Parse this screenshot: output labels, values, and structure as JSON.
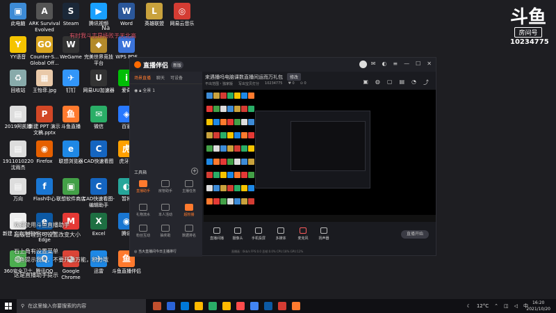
{
  "desktop": {
    "icons": [
      {
        "label": "此电脑",
        "color": "#3d8bd6",
        "glyph": "▣"
      },
      {
        "label": "ARK Survival Evolved",
        "color": "#555",
        "glyph": "A"
      },
      {
        "label": "Steam",
        "color": "#1b2838",
        "glyph": "S"
      },
      {
        "label": "腾讯视频",
        "color": "#19a0ff",
        "glyph": "▶"
      },
      {
        "label": "Word",
        "color": "#2b579a",
        "glyph": "W"
      },
      {
        "label": "英雄联盟",
        "color": "#c9a23d",
        "glyph": "L"
      },
      {
        "label": "网易云音乐",
        "color": "#d43c33",
        "glyph": "◎"
      },
      {
        "label": "YY语音",
        "color": "#f5c400",
        "glyph": "Y"
      },
      {
        "label": "Counter-S... Global Off...",
        "color": "#d9a520",
        "glyph": "GO"
      },
      {
        "label": "WeGame",
        "color": "#333",
        "glyph": "W"
      },
      {
        "label": "完美世界竞技平台",
        "color": "#b38a2b",
        "glyph": "◆"
      },
      {
        "label": "WPS PDF",
        "color": "#3b73d9",
        "glyph": "W"
      },
      {
        "label": "回收站",
        "color": "#8aa",
        "glyph": "♻"
      },
      {
        "label": "王怡菲.jpg",
        "color": "#e9c9a9",
        "glyph": "▦"
      },
      {
        "label": "钉钉",
        "color": "#3296fa",
        "glyph": "✈"
      },
      {
        "label": "网易UU加速器",
        "color": "#333",
        "glyph": "U"
      },
      {
        "label": "爱奇",
        "color": "#00be06",
        "glyph": "i"
      },
      {
        "label": "2019阿凯娜",
        "color": "#ddd",
        "glyph": "▤"
      },
      {
        "label": "新建 PPT 演示文稿.pptx",
        "color": "#d24726",
        "glyph": "P"
      },
      {
        "label": "斗鱼直播",
        "color": "#ff7a2e",
        "glyph": "鱼"
      },
      {
        "label": "微信",
        "color": "#2aae67",
        "glyph": "✉"
      },
      {
        "label": "百家",
        "color": "#2878ff",
        "glyph": "◈"
      },
      {
        "label": "1911010220 沈雨杰",
        "color": "#ddd",
        "glyph": "▤"
      },
      {
        "label": "Firefox",
        "color": "#e66000",
        "glyph": "◉"
      },
      {
        "label": "联想浏览器",
        "color": "#1e88e5",
        "glyph": "e"
      },
      {
        "label": "CAD快速看图",
        "color": "#1565c0",
        "glyph": "C"
      },
      {
        "label": "虎牙直",
        "color": "#ffa000",
        "glyph": "虎"
      },
      {
        "label": "万向",
        "color": "#ddd",
        "glyph": "▤"
      },
      {
        "label": "Flash中心",
        "color": "#1976d2",
        "glyph": "f"
      },
      {
        "label": "联想软件商店",
        "color": "#43a047",
        "glyph": "▣"
      },
      {
        "label": "CAD快速看图-编辑助手",
        "color": "#1565c0",
        "glyph": "C"
      },
      {
        "label": "暂将",
        "color": "#26a69a",
        "glyph": "◐"
      },
      {
        "label": "新建 文本文档",
        "color": "#eee",
        "glyph": "▤"
      },
      {
        "label": "Microsoft Edge",
        "color": "#0c59a4",
        "glyph": "e"
      },
      {
        "label": "",
        "color": "#e53935",
        "glyph": "M"
      },
      {
        "label": "Excel",
        "color": "#1d6f42",
        "glyph": "X"
      },
      {
        "label": "腾讯",
        "color": "#1976d2",
        "glyph": "◉"
      },
      {
        "label": "360安全卫士",
        "color": "#4caf50",
        "glyph": "◍"
      },
      {
        "label": "腾讯QQ",
        "color": "#1e88e5",
        "glyph": "Q"
      },
      {
        "label": "Google Chrome",
        "color": "#db4437",
        "glyph": "◕"
      },
      {
        "label": "迅雷",
        "color": "#1e88e5",
        "glyph": "✈"
      },
      {
        "label": "斗鱼直播伴侣",
        "color": "#ff7a2e",
        "glyph": "鱼"
      }
    ]
  },
  "watermark": {
    "logo": "斗鱼",
    "sub": "房间号",
    "room": "10234775"
  },
  "overlays": {
    "na": "Na",
    "pink_line": "有时我斗志昂扬败于天北高",
    "line1": "欢迎使用斗鱼直播助手",
    "line2": "超级管理员可设置改变大小",
    "line3": "石上角有设置菜单",
    "line4": "斗鱼提示我们，不要开通万能，积分哦",
    "line5": "这是直播助手提示",
    "taskbar_hint": "直播显示不到Ⅲ"
  },
  "app": {
    "brand": "直播伴侣",
    "version": "新版",
    "side_tabs": [
      "场景直播",
      "聊天",
      "可设备"
    ],
    "scene_label": "全景 1",
    "tools_title": "工具箱",
    "tools": [
      {
        "label": "直播助手",
        "orange": true
      },
      {
        "label": "房管助手",
        "orange": false
      },
      {
        "label": "主播任务",
        "orange": false
      },
      {
        "label": "礼物流水",
        "orange": false
      },
      {
        "label": "本人活动",
        "orange": false
      },
      {
        "label": "超粉播",
        "orange": true
      },
      {
        "label": "粉丝互动",
        "orange": false
      },
      {
        "label": "抽奖助",
        "orange": false
      },
      {
        "label": "数据排名",
        "orange": false
      }
    ],
    "side_bottom": "◎ 当大直播间今日主播排行",
    "stream_title": "来遇播吗电脑课数直播间运而万礼包",
    "modify": "修改",
    "info": [
      "不出范围・独家版",
      "写出宝贝打分",
      "10234775",
      "♥ 0",
      "⊙ 0"
    ],
    "bottom_items": [
      "直播间播",
      "摄像头",
      "手机投屏",
      "多媒体",
      "麦克风",
      "扬声器"
    ],
    "start_live": "直播开始",
    "stats": "直播画 : 0kb/s  FPS:0.0  丢帧:0.0%  CPU:18%  GPU:12%"
  },
  "taskbar": {
    "search_placeholder": "在这里输入你要搜索的内容",
    "apps": [
      "#c1502e",
      "#2b63d6",
      "#0078d7",
      "#ffb900",
      "#2aae67",
      "#ffb900",
      "#ff4c4c",
      "#4285f4",
      "#0c59a4",
      "#d43c33",
      "#ff7a2e"
    ],
    "weather": "12°C",
    "ime": "中",
    "time": "16:20",
    "date": "2021/10/20"
  }
}
